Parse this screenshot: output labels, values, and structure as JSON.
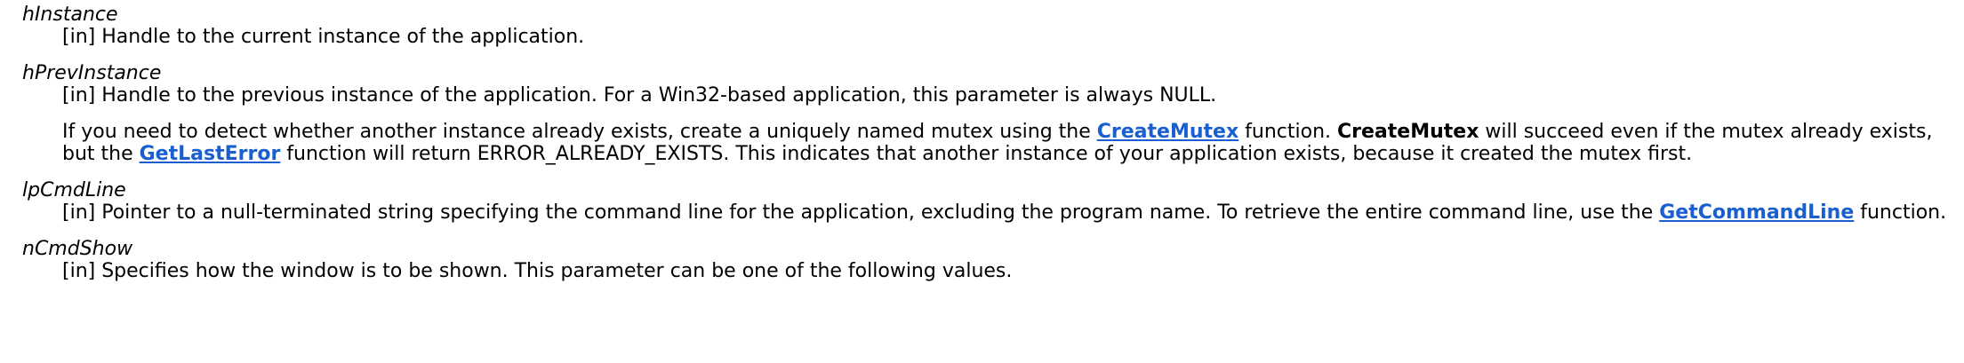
{
  "params": {
    "hInstance": {
      "name": "hInstance",
      "desc": "[in] Handle to the current instance of the application."
    },
    "hPrevInstance": {
      "name": "hPrevInstance",
      "desc": "[in] Handle to the previous instance of the application. For a Win32-based application, this parameter is always NULL.",
      "note_part1": "If you need to detect whether another instance already exists, create a uniquely named mutex using the ",
      "link_createmutex": "CreateMutex",
      "note_part2": " function. ",
      "strong_createmutex": "CreateMutex",
      "note_part3": " will succeed even if the mutex already exists, but the ",
      "link_getlasterror": "GetLastError",
      "note_part4": " function will return ERROR_ALREADY_EXISTS. This indicates that another instance of your application exists, because it created the mutex first."
    },
    "lpCmdLine": {
      "name": "lpCmdLine",
      "desc_part1": "[in] Pointer to a null-terminated string specifying the command line for the application, excluding the program name. To retrieve the entire command line, use the ",
      "link_getcommandline": "GetCommandLine",
      "desc_part2": " function."
    },
    "nCmdShow": {
      "name": "nCmdShow",
      "desc": "[in] Specifies how the window is to be shown. This parameter can be one of the following values."
    }
  },
  "colors": {
    "link": "#1a5fcf",
    "text": "#000000",
    "background": "#ffffff"
  }
}
